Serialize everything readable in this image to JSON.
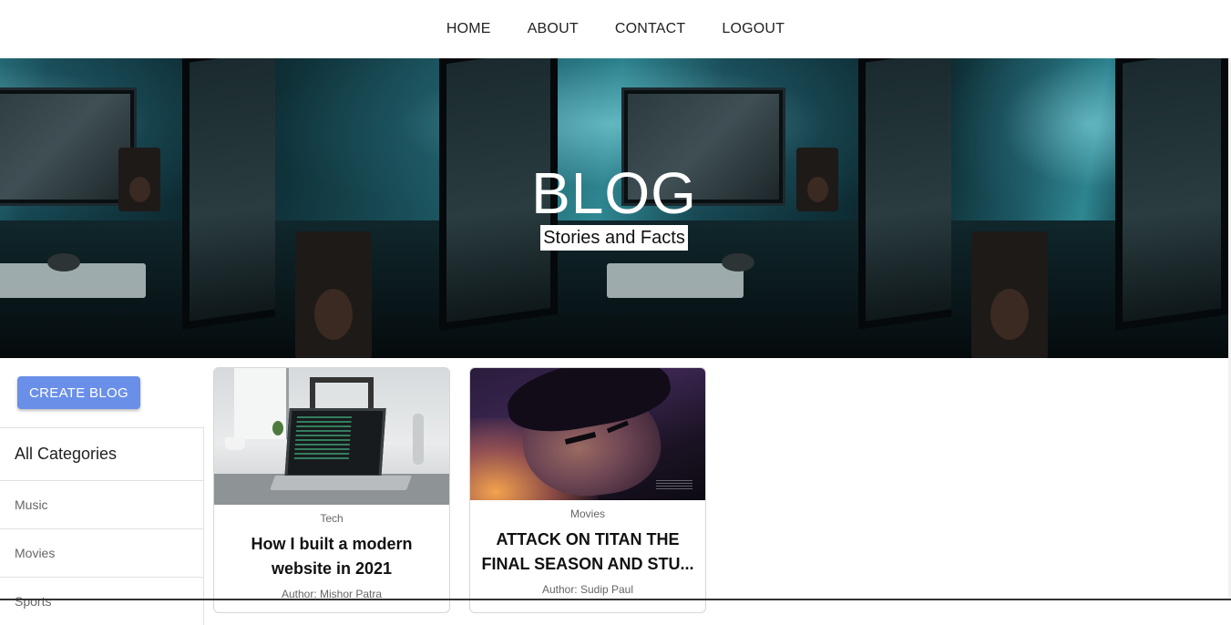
{
  "nav": {
    "items": [
      {
        "label": "HOME"
      },
      {
        "label": "ABOUT"
      },
      {
        "label": "CONTACT"
      },
      {
        "label": "LOGOUT"
      }
    ]
  },
  "hero": {
    "title": "BLOG",
    "subtitle": "Stories and Facts"
  },
  "sidebar": {
    "create_button": "CREATE BLOG",
    "categories_header": "All Categories",
    "categories": [
      {
        "label": "Music"
      },
      {
        "label": "Movies"
      },
      {
        "label": "Sports"
      }
    ]
  },
  "posts": [
    {
      "category": "Tech",
      "title": "How I built a modern website in 2021",
      "author": "Author: Mishor Patra"
    },
    {
      "category": "Movies",
      "title": "ATTACK ON TITAN THE FINAL SEASON AND STU...",
      "author": "Author: Sudip Paul"
    }
  ],
  "colors": {
    "accent": "#6a8fe8"
  }
}
